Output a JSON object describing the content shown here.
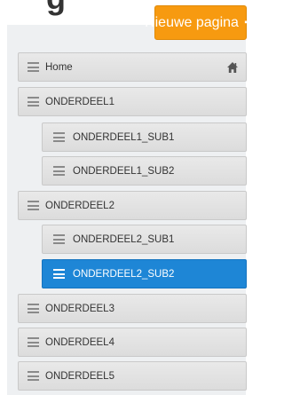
{
  "header": {
    "title_fragment": "g"
  },
  "toolbar": {
    "new_page_label": "Nieuwe pagina",
    "new_page_icon": "plus-icon",
    "accent_color": "#f79a10"
  },
  "tree": {
    "active_color": "#1e86d6",
    "items": [
      {
        "label": "Home",
        "icon": "home-icon"
      },
      {
        "label": "ONDERDEEL1"
      },
      {
        "label": "ONDERDEEL1_SUB1"
      },
      {
        "label": "ONDERDEEL1_SUB2"
      },
      {
        "label": "ONDERDEEL2"
      },
      {
        "label": "ONDERDEEL2_SUB1"
      },
      {
        "label": "ONDERDEEL2_SUB2",
        "active": true
      },
      {
        "label": "ONDERDEEL3"
      },
      {
        "label": "ONDERDEEL4"
      },
      {
        "label": "ONDERDEEL5"
      }
    ]
  }
}
